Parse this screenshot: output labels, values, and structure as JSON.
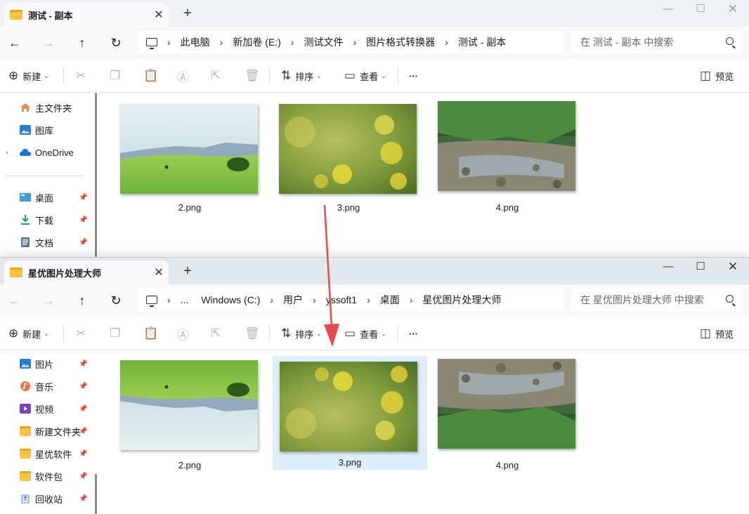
{
  "windows": [
    {
      "tab_title": "测试 - 副本",
      "breadcrumb": [
        "此电脑",
        "新加卷 (E:)",
        "测试文件",
        "图片格式转换器",
        "测试 - 副本"
      ],
      "search_placeholder": "在 测试 - 副本 中搜索",
      "sidebar": [
        {
          "label": "主文件夹",
          "icon": "home-icon"
        },
        {
          "label": "图库",
          "icon": "gallery-icon"
        },
        {
          "label": "OneDrive",
          "icon": "cloud-icon"
        },
        {
          "label": "桌面",
          "icon": "desktop-icon",
          "pinned": true
        },
        {
          "label": "下载",
          "icon": "download-icon",
          "pinned": true
        },
        {
          "label": "文档",
          "icon": "document-icon",
          "pinned": true
        }
      ],
      "files": [
        "2.png",
        "3.png",
        "4.png"
      ]
    },
    {
      "tab_title": "星优图片处理大师",
      "breadcrumb": [
        "...",
        "Windows (C:)",
        "用户",
        "yssoft1",
        "桌面",
        "星优图片处理大师"
      ],
      "search_placeholder": "在 星优图片处理大师 中搜索",
      "sidebar": [
        {
          "label": "图片",
          "icon": "pictures-icon",
          "pinned": true
        },
        {
          "label": "音乐",
          "icon": "music-icon",
          "pinned": true
        },
        {
          "label": "视频",
          "icon": "video-icon",
          "pinned": true
        },
        {
          "label": "新建文件夹",
          "icon": "folder-icon",
          "pinned": true
        },
        {
          "label": "星优软件",
          "icon": "folder-icon",
          "pinned": true
        },
        {
          "label": "软件包",
          "icon": "folder-icon",
          "pinned": true
        },
        {
          "label": "回收站",
          "icon": "recycle-bin-icon",
          "pinned": true
        }
      ],
      "files": [
        "2.png",
        "3.png",
        "4.png"
      ],
      "selected_file": "3.png"
    }
  ],
  "toolbar": {
    "new_label": "新建",
    "sort_label": "排序",
    "view_label": "查看",
    "more_label": "···",
    "preview_label": "预览"
  },
  "colors": {
    "accent": "#0067c0",
    "selection": "#dfeefb",
    "arrow": "#e84a4a"
  }
}
